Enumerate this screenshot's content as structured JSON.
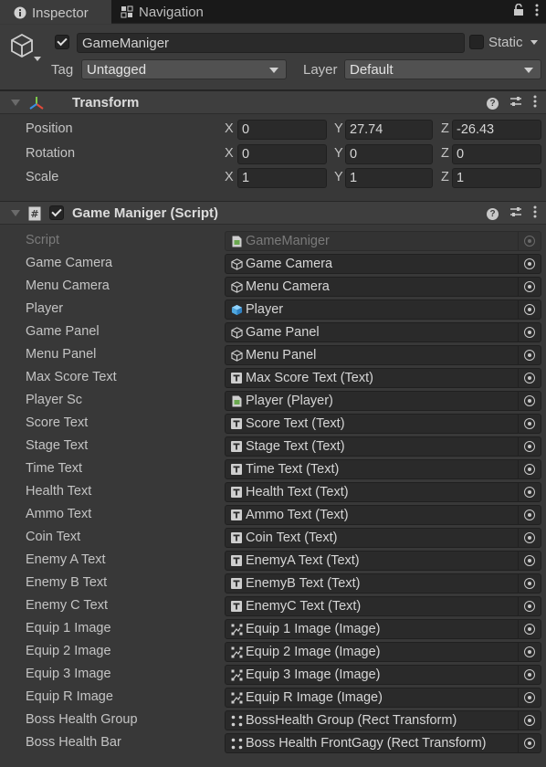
{
  "tabs": [
    {
      "label": "Inspector",
      "icon": "info-icon"
    },
    {
      "label": "Navigation",
      "icon": "navigation-icon"
    }
  ],
  "object": {
    "name": "GameManiger",
    "active": true,
    "static_label": "Static",
    "static": false,
    "tag_label": "Tag",
    "tag_value": "Untagged",
    "layer_label": "Layer",
    "layer_value": "Default"
  },
  "transform": {
    "title": "Transform",
    "rows": [
      {
        "name": "Position",
        "x": "0",
        "y": "27.74",
        "z": "-26.43"
      },
      {
        "name": "Rotation",
        "x": "0",
        "y": "0",
        "z": "0"
      },
      {
        "name": "Scale",
        "x": "1",
        "y": "1",
        "z": "1"
      }
    ],
    "axis_labels": {
      "x": "X",
      "y": "Y",
      "z": "Z"
    }
  },
  "script_component": {
    "title": "Game Maniger (Script)",
    "enabled": true,
    "fields": [
      {
        "label": "Script",
        "value": "GameManiger",
        "icon": "script-file-icon",
        "disabled": true
      },
      {
        "label": "Game Camera",
        "value": "Game Camera",
        "icon": "gameobject-cube-icon"
      },
      {
        "label": "Menu Camera",
        "value": "Menu Camera",
        "icon": "gameobject-cube-icon"
      },
      {
        "label": "Player",
        "value": "Player",
        "icon": "prefab-cube-icon"
      },
      {
        "label": "Game Panel",
        "value": "Game Panel",
        "icon": "gameobject-cube-icon"
      },
      {
        "label": "Menu Panel",
        "value": "Menu Panel",
        "icon": "gameobject-cube-icon"
      },
      {
        "label": "Max Score Text",
        "value": "Max Score Text (Text)",
        "icon": "text-component-icon"
      },
      {
        "label": "Player Sc",
        "value": "Player (Player)",
        "icon": "script-file-icon"
      },
      {
        "label": "Score Text",
        "value": "Score Text (Text)",
        "icon": "text-component-icon"
      },
      {
        "label": "Stage Text",
        "value": "Stage Text (Text)",
        "icon": "text-component-icon"
      },
      {
        "label": "Time Text",
        "value": "Time Text (Text)",
        "icon": "text-component-icon"
      },
      {
        "label": "Health Text",
        "value": "Health Text (Text)",
        "icon": "text-component-icon"
      },
      {
        "label": "Ammo Text",
        "value": "Ammo Text (Text)",
        "icon": "text-component-icon"
      },
      {
        "label": "Coin Text",
        "value": "Coin Text (Text)",
        "icon": "text-component-icon"
      },
      {
        "label": "Enemy A Text",
        "value": "EnemyA Text (Text)",
        "icon": "text-component-icon"
      },
      {
        "label": "Enemy B Text",
        "value": "EnemyB Text (Text)",
        "icon": "text-component-icon"
      },
      {
        "label": "Enemy C Text",
        "value": "EnemyC Text (Text)",
        "icon": "text-component-icon"
      },
      {
        "label": "Equip 1 Image",
        "value": "Equip 1 Image (Image)",
        "icon": "image-component-icon"
      },
      {
        "label": "Equip 2 Image",
        "value": "Equip 2 Image (Image)",
        "icon": "image-component-icon"
      },
      {
        "label": "Equip 3 Image",
        "value": "Equip 3 Image (Image)",
        "icon": "image-component-icon"
      },
      {
        "label": "Equip R Image",
        "value": "Equip R Image (Image)",
        "icon": "image-component-icon"
      },
      {
        "label": "Boss Health Group",
        "value": "BossHealth Group (Rect Transform)",
        "icon": "rect-transform-icon"
      },
      {
        "label": "Boss Health Bar",
        "value": "Boss Health FrontGagy (Rect Transform)",
        "icon": "rect-transform-icon"
      }
    ]
  }
}
